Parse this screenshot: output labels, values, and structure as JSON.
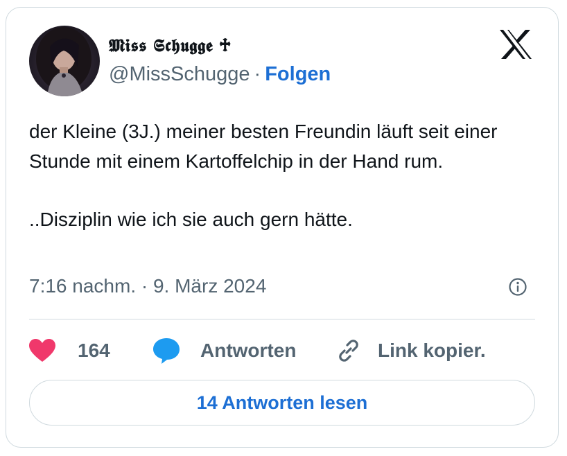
{
  "author": {
    "display_name": "𝕸𝖎𝖘𝖘 𝕾𝖈𝖍𝖚𝖌𝖌𝖊 ♱",
    "handle": "@MissSchugge",
    "separator": "·",
    "follow_label": "Folgen",
    "avatar_icon": "profile-photo"
  },
  "platform": {
    "logo_icon": "x-logo"
  },
  "tweet": {
    "lines_paragraph_1": "der Kleine (3J.) meiner besten Freundin läuft seit einer Stunde mit einem Kartoffelchip in der Hand rum.",
    "paragraph_2": "..Disziplin wie ich sie auch gern hätte.",
    "timestamp": "7:16 nachm. · 9. März 2024",
    "info_icon": "info-icon"
  },
  "actions": {
    "like_count": "164",
    "reply_label": "Antworten",
    "copy_link_label": "Link kopier."
  },
  "read_replies_label": "14 Antworten lesen",
  "colors": {
    "accent": "#1d6fd4",
    "heart": "#f0386b",
    "reply_bubble": "#1d9bf0",
    "muted_text": "#536471",
    "border": "#cfd9de"
  }
}
